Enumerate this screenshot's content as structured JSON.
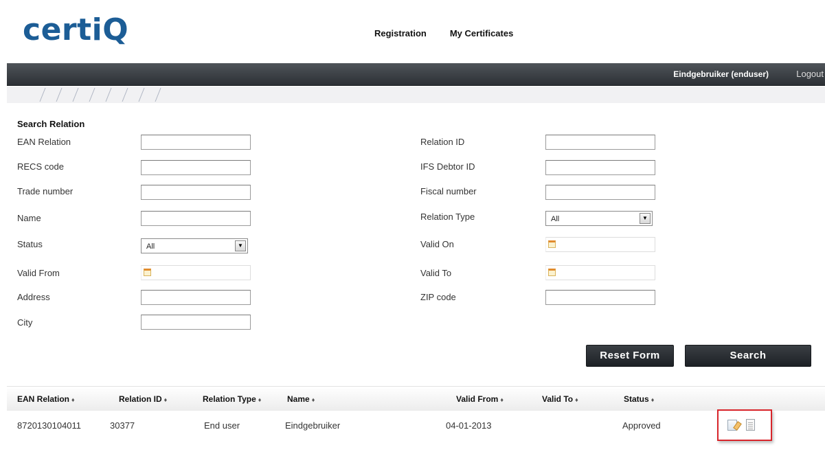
{
  "header": {
    "logo": "certiQ",
    "nav": [
      "Registration",
      "My Certificates"
    ],
    "user": "Eindgebruiker (enduser)",
    "logout": "Logout"
  },
  "search": {
    "title": "Search Relation",
    "left_fields": {
      "ean_relation": "EAN Relation",
      "recs_code": "RECS code",
      "trade_number": "Trade number",
      "name": "Name",
      "status": "Status",
      "valid_from": "Valid From",
      "address": "Address",
      "city": "City"
    },
    "right_fields": {
      "relation_id": "Relation ID",
      "ifs_debtor_id": "IFS Debtor ID",
      "fiscal_number": "Fiscal number",
      "relation_type": "Relation Type",
      "valid_on": "Valid On",
      "valid_to": "Valid To",
      "zip_code": "ZIP code"
    },
    "status_value": "All",
    "relation_type_value": "All",
    "reset_label": "Reset Form",
    "search_label": "Search"
  },
  "table": {
    "columns": [
      "EAN Relation",
      "Relation ID",
      "Relation Type",
      "Name",
      "Valid From",
      "Valid To",
      "Status"
    ],
    "sort_glyph": "♦",
    "rows": [
      {
        "ean_relation": "8720130104011",
        "relation_id": "30377",
        "relation_type": "End user",
        "name": "Eindgebruiker",
        "valid_from": "04-01-2013",
        "valid_to": "",
        "status": "Approved"
      }
    ]
  },
  "colors": {
    "logo": "#1c5d96",
    "userbar": "#2c3035",
    "highlight": "#d8242a"
  },
  "icons": [
    "calendar-icon",
    "edit-icon",
    "details-icon",
    "dropdown-arrow-icon",
    "sort-icon"
  ]
}
